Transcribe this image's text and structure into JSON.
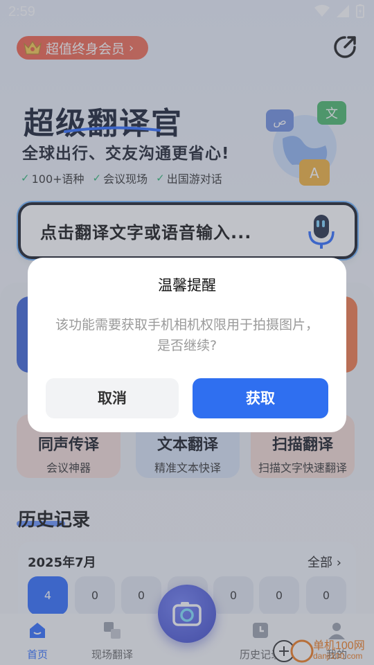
{
  "status_bar": {
    "time": "2:59"
  },
  "vip_badge": {
    "label": "超值终身会员"
  },
  "hero": {
    "title": "超级翻译官",
    "subtitle": "全球出行、交友沟通更省心!",
    "features": [
      "100+语种",
      "会议现场",
      "出国游对话"
    ]
  },
  "translate_bar": {
    "placeholder": "点击翻译文字或语音输入..."
  },
  "functions": [
    {
      "title": "同声传译",
      "subtitle": "会议神器"
    },
    {
      "title": "文本翻译",
      "subtitle": "精准文本快译"
    },
    {
      "title": "扫描翻译",
      "subtitle": "扫描文字快速翻译"
    }
  ],
  "history": {
    "title": "历史记录",
    "month": "2025年7月",
    "all_label": "全部",
    "days": [
      "4",
      "0",
      "0",
      "0",
      "0",
      "0",
      "0"
    ]
  },
  "bottom_nav": {
    "home": "首页",
    "scene": "现场翻译",
    "history": "历史记录",
    "mine": "我的"
  },
  "dialog": {
    "title": "温馨提醒",
    "message": "该功能需要获取手机相机权限用于拍摄图片，是否继续?",
    "cancel_label": "取消",
    "confirm_label": "获取"
  },
  "watermark": {
    "line1": "单机100网",
    "line2": "danji100.com"
  },
  "colors": {
    "accent": "#2f6ff0",
    "vip": "#f25e48",
    "overlay": "rgba(90,95,110,0.38)"
  }
}
